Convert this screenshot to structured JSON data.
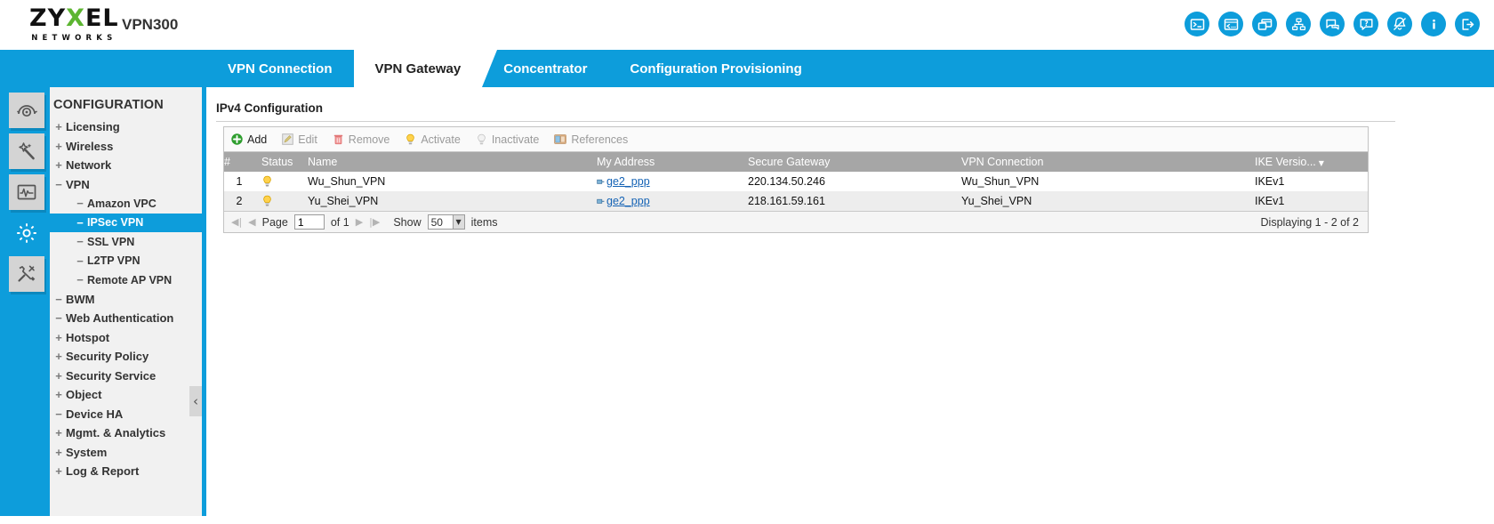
{
  "header": {
    "logo": {
      "part1": "ZY",
      "part2": "X",
      "part3": "EL",
      "sub": "NETWORKS"
    },
    "model": "VPN300",
    "icons": [
      {
        "name": "cli-icon",
        "title": "CLI"
      },
      {
        "name": "console-icon",
        "title": "Console"
      },
      {
        "name": "web-window-icon",
        "title": "Web Console"
      },
      {
        "name": "site-map-icon",
        "title": "Site Map"
      },
      {
        "name": "chat-icon",
        "title": "Chat"
      },
      {
        "name": "help-icon",
        "title": "Help"
      },
      {
        "name": "notification-bell-icon",
        "title": "Notification"
      },
      {
        "name": "info-icon",
        "title": "About"
      },
      {
        "name": "logout-icon",
        "title": "Logout"
      }
    ]
  },
  "tabs": [
    {
      "label": "VPN Connection",
      "active": false
    },
    {
      "label": "VPN Gateway",
      "active": true
    },
    {
      "label": "Concentrator",
      "active": false
    },
    {
      "label": "Configuration Provisioning",
      "active": false
    }
  ],
  "rail": [
    {
      "name": "dashboard-icon",
      "active": false
    },
    {
      "name": "wizard-wand-icon",
      "active": false
    },
    {
      "name": "monitor-graph-icon",
      "active": false
    },
    {
      "name": "configuration-gear-icon",
      "active": true
    },
    {
      "name": "maintenance-tools-icon",
      "active": false
    }
  ],
  "sidebar": {
    "title": "CONFIGURATION",
    "items": [
      {
        "label": "Licensing",
        "twisty": "+",
        "level": 1,
        "selected": false
      },
      {
        "label": "Wireless",
        "twisty": "+",
        "level": 1,
        "selected": false
      },
      {
        "label": "Network",
        "twisty": "+",
        "level": 1,
        "selected": false
      },
      {
        "label": "VPN",
        "twisty": "−",
        "level": 1,
        "selected": false
      },
      {
        "label": "Amazon VPC",
        "twisty": "−",
        "level": 2,
        "selected": false
      },
      {
        "label": "IPSec VPN",
        "twisty": "−",
        "level": 2,
        "selected": true
      },
      {
        "label": "SSL VPN",
        "twisty": "−",
        "level": 2,
        "selected": false
      },
      {
        "label": "L2TP VPN",
        "twisty": "−",
        "level": 2,
        "selected": false
      },
      {
        "label": "Remote AP VPN",
        "twisty": "−",
        "level": 2,
        "selected": false
      },
      {
        "label": "BWM",
        "twisty": "−",
        "level": 1,
        "selected": false
      },
      {
        "label": "Web Authentication",
        "twisty": "−",
        "level": 1,
        "selected": false
      },
      {
        "label": "Hotspot",
        "twisty": "+",
        "level": 1,
        "selected": false
      },
      {
        "label": "Security Policy",
        "twisty": "+",
        "level": 1,
        "selected": false
      },
      {
        "label": "Security Service",
        "twisty": "+",
        "level": 1,
        "selected": false
      },
      {
        "label": "Object",
        "twisty": "+",
        "level": 1,
        "selected": false
      },
      {
        "label": "Device HA",
        "twisty": "−",
        "level": 1,
        "selected": false
      },
      {
        "label": "Mgmt. & Analytics",
        "twisty": "+",
        "level": 1,
        "selected": false
      },
      {
        "label": "System",
        "twisty": "+",
        "level": 1,
        "selected": false
      },
      {
        "label": "Log & Report",
        "twisty": "+",
        "level": 1,
        "selected": false
      }
    ],
    "collapse_handle": "‹"
  },
  "panel": {
    "title": "IPv4 Configuration",
    "toolbar": [
      {
        "label": "Add",
        "name": "add-button",
        "icon": "plus-circle-icon",
        "enabled": true
      },
      {
        "label": "Edit",
        "name": "edit-button",
        "icon": "pencil-icon",
        "enabled": false
      },
      {
        "label": "Remove",
        "name": "remove-button",
        "icon": "trash-icon",
        "enabled": false
      },
      {
        "label": "Activate",
        "name": "activate-button",
        "icon": "bulb-on-icon",
        "enabled": false
      },
      {
        "label": "Inactivate",
        "name": "inactivate-button",
        "icon": "bulb-off-icon",
        "enabled": false
      },
      {
        "label": "References",
        "name": "references-button",
        "icon": "references-icon",
        "enabled": false
      }
    ],
    "columns": [
      {
        "label": "#",
        "key": "num",
        "cls": "c-num"
      },
      {
        "label": "Status",
        "key": "status",
        "cls": "c-stat"
      },
      {
        "label": "Name",
        "key": "name",
        "cls": "c-name"
      },
      {
        "label": "My Address",
        "key": "addr",
        "cls": "c-addr"
      },
      {
        "label": "Secure Gateway",
        "key": "sgw",
        "cls": "c-sgw"
      },
      {
        "label": "VPN Connection",
        "key": "conn",
        "cls": "c-conn"
      },
      {
        "label": "IKE Versio...",
        "key": "ike",
        "cls": "c-ike"
      }
    ],
    "rows": [
      {
        "num": "1",
        "status": "active-bulb-icon",
        "name": "Wu_Shun_VPN",
        "addr": "ge2_ppp",
        "sgw": "220.134.50.246",
        "conn": "Wu_Shun_VPN",
        "ike": "IKEv1"
      },
      {
        "num": "2",
        "status": "active-bulb-icon",
        "name": "Yu_Shei_VPN",
        "addr": "ge2_ppp",
        "sgw": "218.161.59.161",
        "conn": "Yu_Shei_VPN",
        "ike": "IKEv1"
      }
    ],
    "footer": {
      "first": "◀|",
      "prev": "◀",
      "page_label": "Page",
      "page_value": "1",
      "of_label": "of 1",
      "next": "▶",
      "last": "|▶",
      "show_label": "Show",
      "page_size": "50",
      "items_label": "items",
      "displaying": "Displaying 1 - 2 of 2"
    }
  },
  "colors": {
    "brand_blue": "#0d9ddb",
    "logo_green": "#5cb531",
    "header_grey": "#a6a6a6",
    "link_blue": "#1563b5"
  }
}
